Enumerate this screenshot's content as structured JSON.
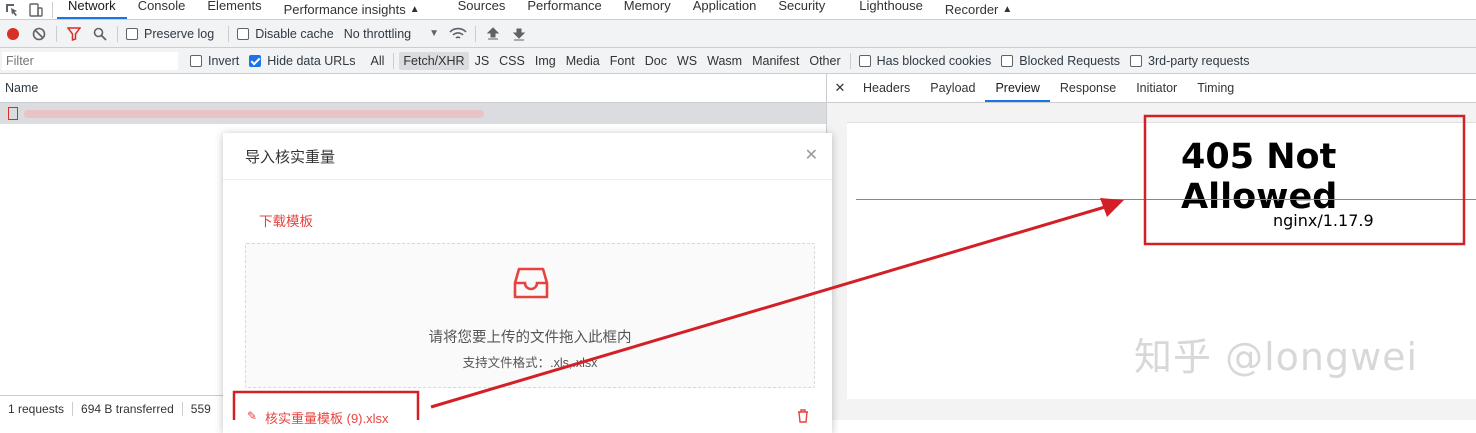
{
  "devtools": {
    "tabs": [
      {
        "label": "Network",
        "active": true
      },
      {
        "label": "Console"
      },
      {
        "label": "Elements"
      },
      {
        "label": "Performance insights"
      },
      {
        "label": "Sources"
      },
      {
        "label": "Performance"
      },
      {
        "label": "Memory"
      },
      {
        "label": "Application"
      },
      {
        "label": "Security"
      },
      {
        "label": "Lighthouse"
      },
      {
        "label": "Recorder"
      }
    ],
    "toolbar": {
      "preserve_log": "Preserve log",
      "disable_cache": "Disable cache",
      "throttling": "No throttling"
    },
    "filterbar": {
      "placeholder": "Filter",
      "invert": "Invert",
      "hide_data_urls": "Hide data URLs",
      "types": [
        "All",
        "Fetch/XHR",
        "JS",
        "CSS",
        "Img",
        "Media",
        "Font",
        "Doc",
        "WS",
        "Wasm",
        "Manifest",
        "Other"
      ],
      "selected_type": "Fetch/XHR",
      "has_blocked_cookies": "Has blocked cookies",
      "blocked_requests": "Blocked Requests",
      "third_party": "3rd-party requests"
    },
    "columns": {
      "name": "Name"
    },
    "detail_tabs": [
      {
        "label": "Headers"
      },
      {
        "label": "Payload"
      },
      {
        "label": "Preview",
        "active": true
      },
      {
        "label": "Response"
      },
      {
        "label": "Initiator"
      },
      {
        "label": "Timing"
      }
    ],
    "status": {
      "requests": "1 requests",
      "transferred": "694 B transferred",
      "partial": "559"
    }
  },
  "preview": {
    "heading": "405 Not Allowed",
    "server": "nginx/1.17.9"
  },
  "dialog": {
    "title": "导入核实重量",
    "download_link": "下载模板",
    "drop_text": "请将您要上传的文件拖入此框内",
    "drop_hint": "支持文件格式：.xls,.xlsx",
    "file_name": "核实重量模板 (9).xlsx"
  },
  "watermark": "知乎 @longwei",
  "colors": {
    "accent": "#1a73e8",
    "annotation": "#d32027",
    "link_red": "#e64340"
  }
}
